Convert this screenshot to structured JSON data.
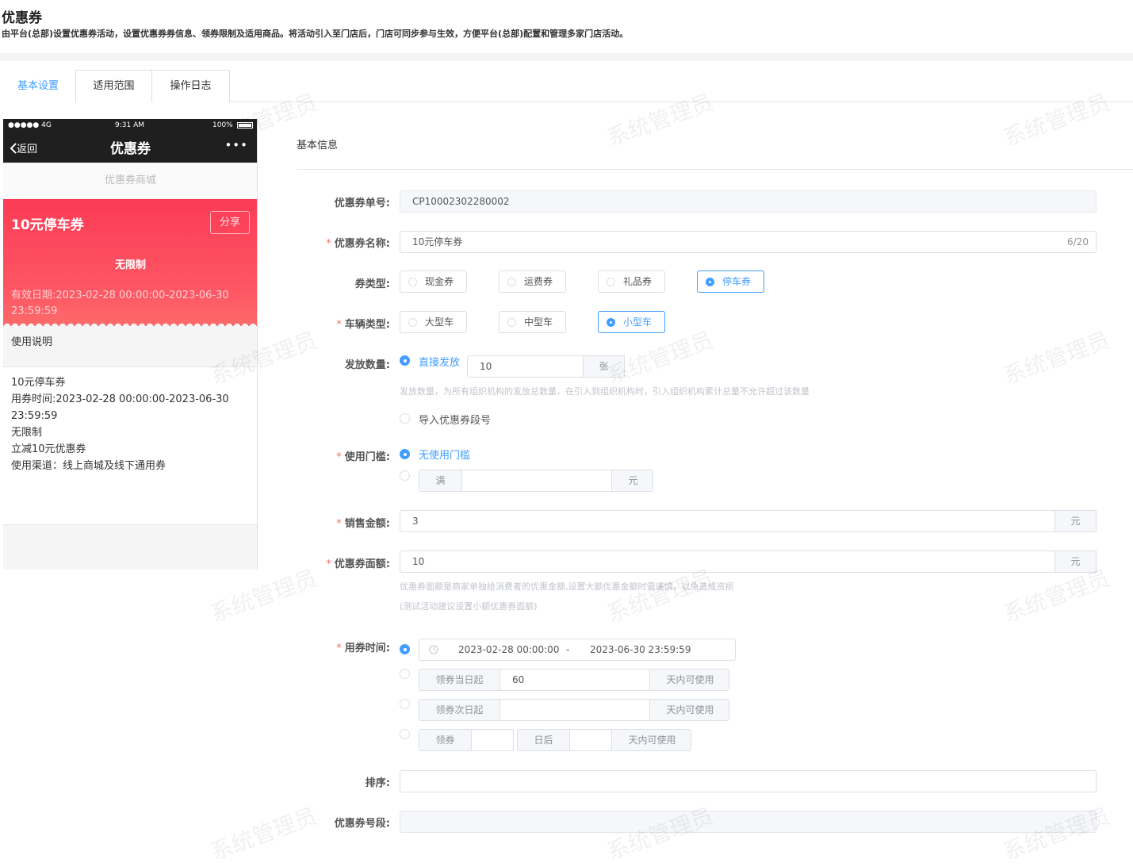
{
  "header": {
    "title": "优惠券",
    "description": "由平台(总部)设置优惠券活动，设置优惠券券信息、领券限制及适用商品。将活动引入至门店后，门店可同步参与生效，方便平台(总部)配置和管理多家门店活动。"
  },
  "tabs": [
    "基本设置",
    "适用范围",
    "操作日志"
  ],
  "watermark": "系统管理员",
  "phone": {
    "signal": "●●●●● 4G",
    "time": "9:31 AM",
    "battery": "100%",
    "back": "返回",
    "title": "优惠券",
    "more": "•••",
    "shop": "优惠券商城",
    "coupon_name": "10元停车券",
    "share": "分享",
    "limit": "无限制",
    "valid": "有效日期:2023-02-28 00:00:00-2023-06-30 23:59:59",
    "usage_title": "使用说明",
    "usage_lines": [
      "10元停车券",
      "用券时间:2023-02-28 00:00:00-2023-06-30 23:59:59",
      "无限制",
      "立减10元优惠券",
      "使用渠道：线上商城及线下通用券"
    ]
  },
  "form": {
    "section": "基本信息",
    "coupon_no": {
      "label": "优惠券单号:",
      "value": "CP10002302280002"
    },
    "coupon_name": {
      "label": "优惠券名称:",
      "value": "10元停车券",
      "count": "6/20"
    },
    "coupon_type": {
      "label": "券类型:",
      "options": [
        "现金券",
        "运费券",
        "礼品券",
        "停车券"
      ],
      "selected": "停车券"
    },
    "vehicle_type": {
      "label": "车辆类型:",
      "options": [
        "大型车",
        "中型车",
        "小型车"
      ],
      "selected": "小型车"
    },
    "issue_qty": {
      "label": "发放数量:",
      "direct": "直接发放",
      "value": "10",
      "unit": "张",
      "hint": "发放数量，为所有组织机构的发放总数量，在引入到组织机构时，引入组织机构累计总量不允许超过该数量",
      "import": "导入优惠券段号"
    },
    "threshold": {
      "label": "使用门槛:",
      "none": "无使用门槛",
      "full": "满",
      "unit": "元"
    },
    "sale_amount": {
      "label": "销售金额:",
      "value": "3",
      "unit": "元"
    },
    "face_value": {
      "label": "优惠券面额:",
      "value": "10",
      "unit": "元",
      "hint1": "优惠券面额是商家单独给消费者的优惠金额,设置大额优惠金额时需谨慎，以免造成资损",
      "hint2": "(测试活动建议设置小额优惠券面额)"
    },
    "use_time": {
      "label": "用券时间:",
      "start": "2023-02-28 00:00:00",
      "dash": "-",
      "end": "2023-06-30 23:59:59",
      "opt2_prefix": "领券当日起",
      "opt2_value": "60",
      "opt2_suffix": "天内可使用",
      "opt3_prefix": "领券次日起",
      "opt3_suffix": "天内可使用",
      "opt4_prefix": "领券",
      "opt4_mid": "日后",
      "opt4_suffix": "天内可使用"
    },
    "sort": {
      "label": "排序:"
    },
    "segment": {
      "label": "优惠券号段:"
    }
  }
}
